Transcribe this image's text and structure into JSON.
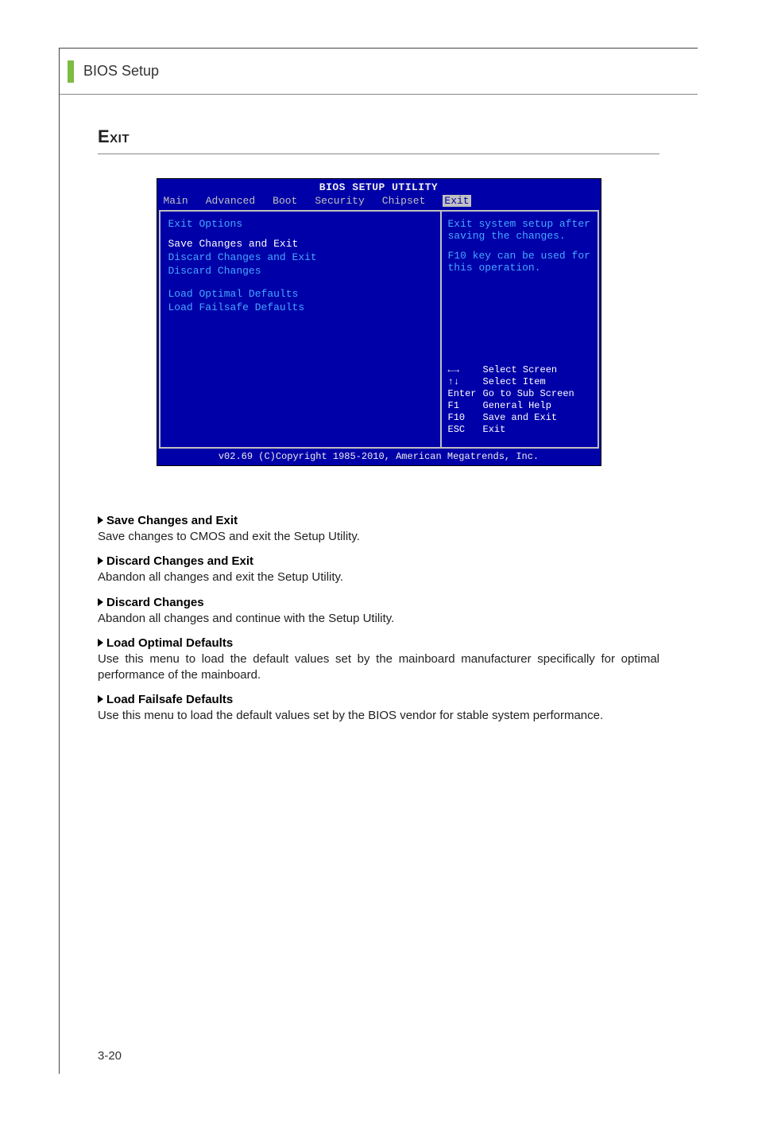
{
  "header": {
    "title": "BIOS Setup"
  },
  "section": {
    "title": "Exit"
  },
  "bios": {
    "utility_title": "BIOS SETUP UTILITY",
    "tabs": [
      "Main",
      "Advanced",
      "Boot",
      "Security",
      "Chipset",
      "Exit"
    ],
    "active_tab": "Exit",
    "left": {
      "heading": "Exit Options",
      "selected": "Save Changes and Exit",
      "items": [
        "Discard Changes and Exit",
        "Discard Changes"
      ],
      "group2": [
        "Load Optimal Defaults",
        "Load Failsafe Defaults"
      ]
    },
    "right": {
      "help1": "Exit system setup after saving the changes.",
      "help2": "F10 key can be used for this operation.",
      "keys": [
        {
          "k": "←→",
          "v": "Select Screen"
        },
        {
          "k": "↑↓",
          "v": "Select Item"
        },
        {
          "k": "Enter",
          "v": "Go to Sub Screen"
        },
        {
          "k": "F1",
          "v": "General Help"
        },
        {
          "k": "F10",
          "v": "Save and Exit"
        },
        {
          "k": "ESC",
          "v": "Exit"
        }
      ]
    },
    "footer": "v02.69 (C)Copyright 1985-2010, American Megatrends, Inc."
  },
  "descriptions": [
    {
      "title": "Save Changes and Exit",
      "text": "Save changes to CMOS and exit the Setup Utility."
    },
    {
      "title": "Discard Changes and Exit",
      "text": "Abandon all changes and exit the Setup Utility."
    },
    {
      "title": "Discard Changes",
      "text": "Abandon all changes and continue with the Setup Utility."
    },
    {
      "title": "Load Optimal Defaults",
      "text": "Use this menu to load the default values set by the mainboard manufacturer specifically for optimal performance of the mainboard."
    },
    {
      "title": "Load Failsafe Defaults",
      "text": "Use this menu to load the default values set by the BIOS vendor for stable system performance."
    }
  ],
  "page_number": "3-20"
}
